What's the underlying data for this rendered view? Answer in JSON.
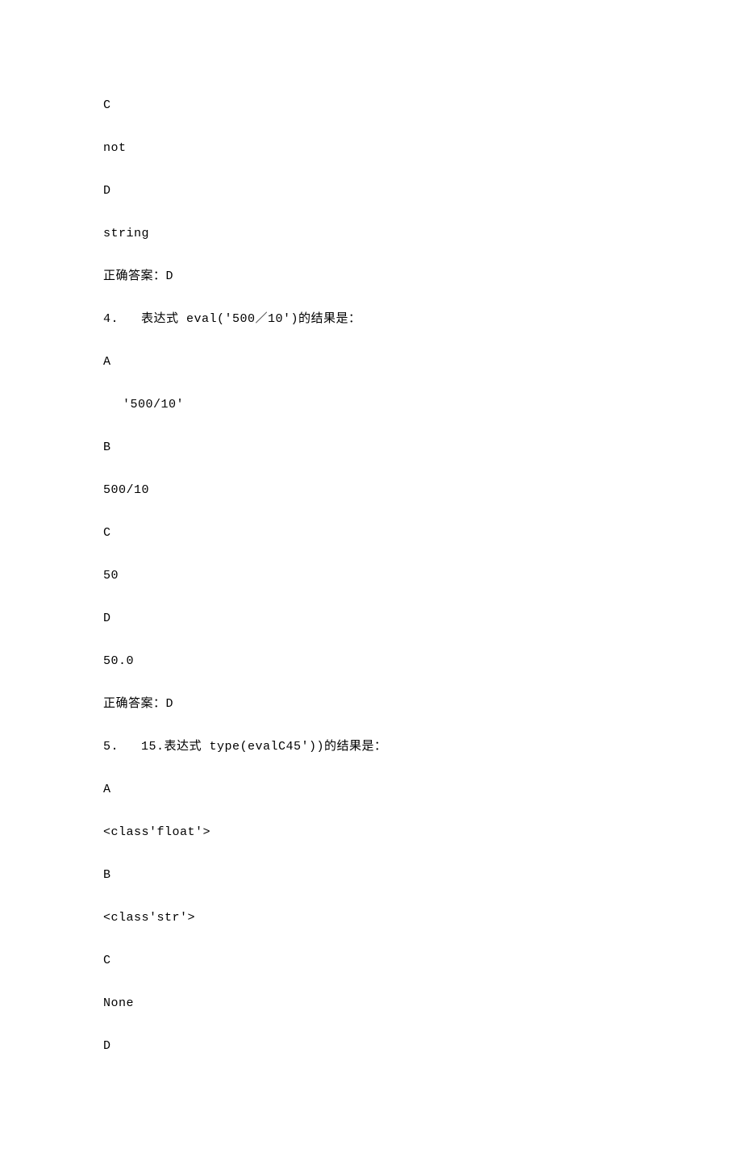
{
  "lines": {
    "l1": "C",
    "l2": "not",
    "l3": "D",
    "l4": "string",
    "l5_label": "正确答案：",
    "l5_value": "D",
    "l6_num": "4.",
    "l6_text": "表达式 eval('500／10')的结果是：",
    "l7": "A",
    "l8": "'500/10'",
    "l9": "B",
    "l10": "500/10",
    "l11": "C",
    "l12": "50",
    "l13": "D",
    "l14": "50.0",
    "l15_label": "正确答案：",
    "l15_value": "D",
    "l16_num": "5.",
    "l16_text": "15.表达式 type(evalC45'))的结果是：",
    "l17": "A",
    "l18": "<class'float'>",
    "l19": "B",
    "l20": "<class'str'>",
    "l21": "C",
    "l22": "None",
    "l23": "D"
  }
}
